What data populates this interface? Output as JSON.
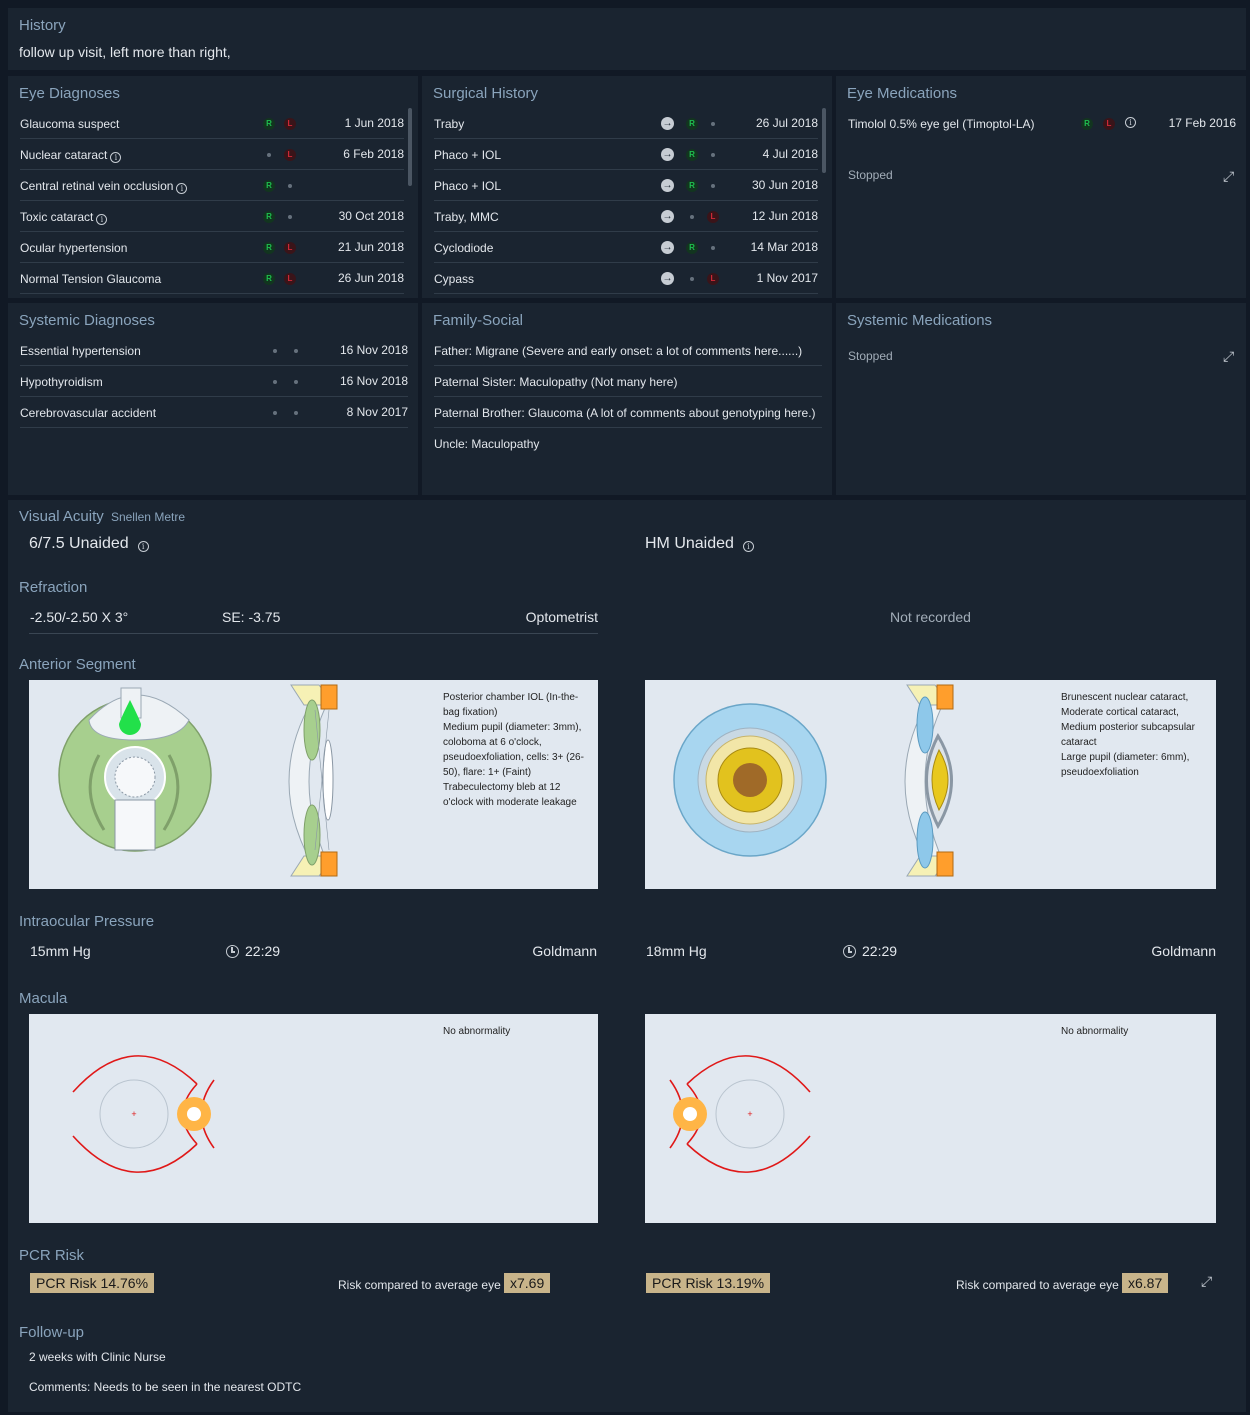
{
  "history": {
    "title": "History",
    "text": "follow up visit, left more than right,"
  },
  "eye_diagnoses": {
    "title": "Eye Diagnoses",
    "rows": [
      {
        "name": "Glaucoma suspect",
        "info": false,
        "r": "R",
        "l": "L",
        "date": "1 Jun 2018"
      },
      {
        "name": "Nuclear cataract",
        "info": true,
        "r": "",
        "l": "L",
        "date": "6 Feb 2018"
      },
      {
        "name": "Central retinal vein occlusion",
        "info": true,
        "r": "R",
        "l": "",
        "date": ""
      },
      {
        "name": "Toxic cataract",
        "info": true,
        "r": "R",
        "l": "",
        "date": "30 Oct 2018"
      },
      {
        "name": "Ocular hypertension",
        "info": false,
        "r": "R",
        "l": "L",
        "date": "21 Jun 2018"
      },
      {
        "name": "Normal Tension Glaucoma",
        "info": false,
        "r": "R",
        "l": "L",
        "date": "26 Jun 2018"
      }
    ]
  },
  "surgical_history": {
    "title": "Surgical History",
    "rows": [
      {
        "name": "Traby",
        "r": "R",
        "l": "",
        "date": "26 Jul 2018"
      },
      {
        "name": "Phaco + IOL",
        "r": "R",
        "l": "",
        "date": "4 Jul 2018"
      },
      {
        "name": "Phaco + IOL",
        "r": "R",
        "l": "",
        "date": "30 Jun 2018"
      },
      {
        "name": "Traby, MMC",
        "r": "",
        "l": "L",
        "date": "12 Jun 2018"
      },
      {
        "name": "Cyclodiode",
        "r": "R",
        "l": "",
        "date": "14 Mar 2018"
      },
      {
        "name": "Cypass",
        "r": "",
        "l": "L",
        "date": "1 Nov 2017"
      }
    ]
  },
  "eye_medications": {
    "title": "Eye Medications",
    "rows": [
      {
        "name": "Timolol 0.5% eye gel (Timoptol-LA)",
        "r": "R",
        "l": "L",
        "date": "17 Feb 2016"
      }
    ],
    "stopped": "Stopped"
  },
  "systemic_diagnoses": {
    "title": "Systemic Diagnoses",
    "rows": [
      {
        "name": "Essential hypertension",
        "date": "16 Nov 2018"
      },
      {
        "name": "Hypothyroidism",
        "date": "16 Nov 2018"
      },
      {
        "name": "Cerebrovascular accident",
        "date": "8 Nov 2017"
      }
    ]
  },
  "family_social": {
    "title": "Family-Social",
    "rows": [
      "Father: Migrane (Severe and early onset: a lot of comments here......)",
      "Paternal Sister: Maculopathy (Not many here)",
      "Paternal Brother: Glaucoma (A lot of comments about genotyping here.)",
      "Uncle: Maculopathy"
    ]
  },
  "systemic_medications": {
    "title": "Systemic Medications",
    "stopped": "Stopped"
  },
  "visual_acuity": {
    "title": "Visual Acuity",
    "unit": "Snellen Metre",
    "right": "6/7.5 Unaided",
    "left": "HM Unaided"
  },
  "refraction": {
    "title": "Refraction",
    "right_value": "-2.50/-2.50 X 3°",
    "right_se": "SE: -3.75",
    "right_source": "Optometrist",
    "left": "Not recorded"
  },
  "anterior_segment": {
    "title": "Anterior Segment",
    "right_desc": "Posterior chamber IOL (In-the-bag fixation)\nMedium pupil (diameter: 3mm), coloboma at 6 o'clock, pseudoexfoliation, cells: 3+ (26-50), flare: 1+ (Faint)\nTrabeculectomy bleb at 12 o'clock with moderate leakage",
    "left_desc": "Brunescent nuclear cataract, Moderate cortical cataract, Medium posterior subcapsular cataract\nLarge pupil (diameter: 6mm), pseudoexfoliation"
  },
  "iop": {
    "title": "Intraocular Pressure",
    "right": {
      "value": "15mm Hg",
      "time": "22:29",
      "method": "Goldmann"
    },
    "left": {
      "value": "18mm Hg",
      "time": "22:29",
      "method": "Goldmann"
    }
  },
  "macula": {
    "title": "Macula",
    "right": "No abnormality",
    "left": "No abnormality"
  },
  "pcr": {
    "title": "PCR Risk",
    "right": {
      "risk": "PCR Risk 14.76%",
      "label": "Risk compared to average eye",
      "mult": "x7.69"
    },
    "left": {
      "risk": "PCR Risk 13.19%",
      "label": "Risk compared to average eye",
      "mult": "x6.87"
    }
  },
  "followup": {
    "title": "Follow-up",
    "text": "2 weeks with Clinic Nurse",
    "comments": "Comments: Needs to be seen in the nearest ODTC"
  },
  "colors": {
    "background": "#111925",
    "panel": "#1a2430",
    "heading": "#8aa4bc",
    "right_eye": "#1fbf4f",
    "left_eye": "#d02a37",
    "badge": "#c8b48a"
  }
}
